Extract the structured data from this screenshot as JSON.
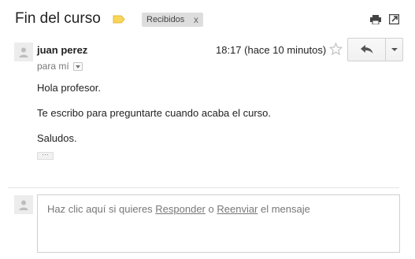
{
  "thread": {
    "subject": "Fin del curso",
    "label": {
      "name": "Recibidos",
      "remove": "x"
    },
    "label_color": "#f9d55a"
  },
  "icons": {
    "label_tag": "label-tag-icon",
    "print": "print-icon",
    "new_window": "new-window-icon",
    "avatar": "person-icon",
    "star": "star-icon",
    "reply": "reply-arrow-icon",
    "more": "chevron-down-icon"
  },
  "message": {
    "sender": "juan perez",
    "recipient": "para mí",
    "time": "18:17 (hace 10 minutos)",
    "body": [
      "Hola profesor.",
      "Te escribo para preguntarte cuando acaba el curso.",
      "Saludos."
    ],
    "ellipsis": "···"
  },
  "reply_box": {
    "prefix": "Haz clic aquí si quieres ",
    "reply_link": "Responder",
    "middle": " o ",
    "forward_link": "Reenviar",
    "suffix": " el mensaje"
  }
}
